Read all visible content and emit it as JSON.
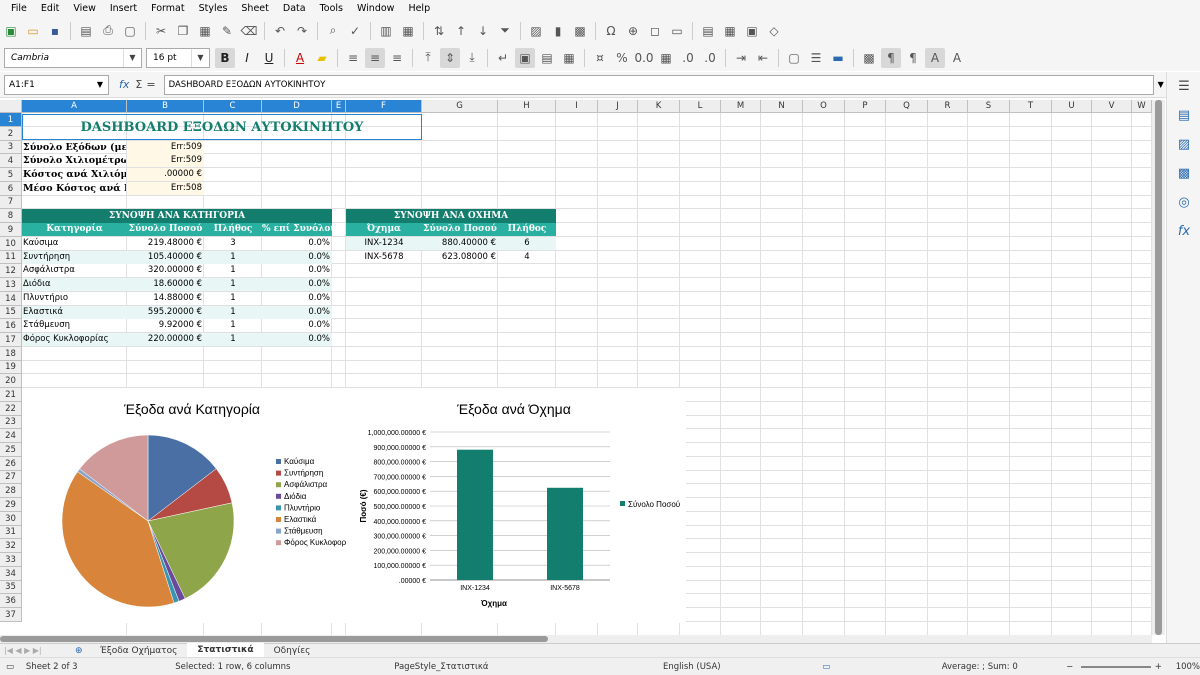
{
  "menu": [
    "File",
    "Edit",
    "View",
    "Insert",
    "Format",
    "Styles",
    "Sheet",
    "Data",
    "Tools",
    "Window",
    "Help"
  ],
  "toolbar": {
    "font_name": "Cambria",
    "font_size": "16 pt"
  },
  "formula_bar": {
    "cell_ref": "A1:F1",
    "content": "DASHBOARD ΕΞΟΔΩΝ ΑΥΤΟΚΙΝΗΤΟΥ"
  },
  "columns": [
    "A",
    "B",
    "C",
    "D",
    "E",
    "F",
    "G",
    "H",
    "I",
    "J",
    "K",
    "L",
    "M",
    "N",
    "O",
    "P",
    "Q",
    "R",
    "S",
    "T",
    "U",
    "V",
    "W"
  ],
  "rows": [
    "1",
    "2",
    "3",
    "4",
    "5",
    "6",
    "7",
    "8",
    "9",
    "10",
    "11",
    "12",
    "13",
    "14",
    "15",
    "16",
    "17",
    "18",
    "19",
    "20",
    "21",
    "22",
    "23",
    "24",
    "25",
    "26",
    "27",
    "28",
    "29",
    "30",
    "31",
    "32",
    "33",
    "34",
    "35",
    "36",
    "37"
  ],
  "sheet": {
    "title": "DASHBOARD ΕΞΟΔΩΝ ΑΥΤΟΚΙΝΗΤΟΥ",
    "summary": [
      {
        "label": "Σύνολο Εξόδων (με Φ",
        "value": "Err:509"
      },
      {
        "label": "Σύνολο Χιλιομέτρων",
        "value": "Err:509"
      },
      {
        "label": "Κόστος ανά Χιλιόμετ",
        "value": ".00000 €"
      },
      {
        "label": "Μέσο Κόστος ανά Κα",
        "value": "Err:508"
      }
    ],
    "cat_table": {
      "title": "ΣΥΝΟΨΗ ΑΝΑ ΚΑΤΗΓΟΡΙΑ",
      "headers": [
        "Κατηγορία",
        "Σύνολο Ποσού",
        "Πλήθος",
        "% επί Συνόλου"
      ],
      "rows": [
        [
          "Καύσιμα",
          "219.48000 €",
          "3",
          "0.0%"
        ],
        [
          "Συντήρηση",
          "105.40000 €",
          "1",
          "0.0%"
        ],
        [
          "Ασφάλιστρα",
          "320.00000 €",
          "1",
          "0.0%"
        ],
        [
          "Διόδια",
          "18.60000 €",
          "1",
          "0.0%"
        ],
        [
          "Πλυντήριο",
          "14.88000 €",
          "1",
          "0.0%"
        ],
        [
          "Ελαστικά",
          "595.20000 €",
          "1",
          "0.0%"
        ],
        [
          "Στάθμευση",
          "9.92000 €",
          "1",
          "0.0%"
        ],
        [
          "Φόρος Κυκλοφορίας",
          "220.00000 €",
          "1",
          "0.0%"
        ]
      ]
    },
    "veh_table": {
      "title": "ΣΥΝΟΨΗ ΑΝΑ ΟΧΗΜΑ",
      "headers": [
        "Όχημα",
        "Σύνολο Ποσού",
        "Πλήθος"
      ],
      "rows": [
        [
          "INX-1234",
          "880.40000 €",
          "6"
        ],
        [
          "INX-5678",
          "623.08000 €",
          "4"
        ]
      ]
    }
  },
  "chart_data": [
    {
      "type": "pie",
      "title": "Έξοδα ανά Κατηγορία",
      "categories": [
        "Καύσιμα",
        "Συντήρηση",
        "Ασφάλιστρα",
        "Διόδια",
        "Πλυντήριο",
        "Ελαστικά",
        "Στάθμευση",
        "Φόρος Κυκλοφορί"
      ],
      "values": [
        219.48,
        105.4,
        320,
        18.6,
        14.88,
        595.2,
        9.92,
        220
      ],
      "colors": [
        "#4a6fa5",
        "#b54a44",
        "#8ea54a",
        "#6a4a9a",
        "#3a95b0",
        "#d8843a",
        "#8aa5cc",
        "#d09a9a"
      ],
      "legend": "right"
    },
    {
      "type": "bar",
      "title": "Έξοδα ανά Όχημα",
      "categories": [
        "INX-1234",
        "INX-5678"
      ],
      "series": [
        {
          "name": "Σύνολο Ποσού",
          "values": [
            880.4,
            623.08
          ]
        }
      ],
      "xlabel": "Όχημα",
      "ylabel": "Ποσό (€)",
      "ylim": [
        0,
        1000
      ],
      "yticks": [
        ".00000 €",
        "100,000.00000 €",
        "200,000.00000 €",
        "300,000.00000 €",
        "400,000.00000 €",
        "500,000.00000 €",
        "600,000.00000 €",
        "700,000.00000 €",
        "800,000.00000 €",
        "900,000.00000 €",
        "1,000,000.00000 €"
      ],
      "color": "#137e6d",
      "grid": true,
      "legend": "right"
    }
  ],
  "tabs": [
    "Έξοδα Οχήματος",
    "Στατιστικά",
    "Οδηγίες"
  ],
  "status": {
    "sheet": "Sheet 2 of 3",
    "selection": "Selected: 1 row, 6 columns",
    "pagestyle": "PageStyle_Στατιστικά",
    "language": "English (USA)",
    "sum": "Average: ; Sum: 0",
    "zoom": "100%"
  }
}
